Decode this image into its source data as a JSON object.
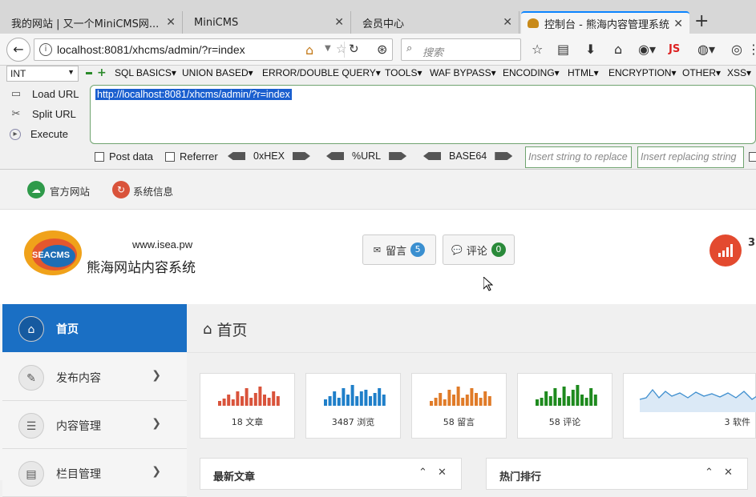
{
  "browser": {
    "tabs": [
      {
        "label": "我的网站 | 又一个MiniCMS网...",
        "active": false
      },
      {
        "label": "MiniCMS",
        "active": false
      },
      {
        "label": "会员中心",
        "active": false
      },
      {
        "label": "控制台 - 熊海内容管理系统",
        "active": true
      }
    ],
    "new_tab_icon": "+",
    "url": "localhost:8081/xhcms/admin/?r=index",
    "search_placeholder": "搜索",
    "js_label": "JS"
  },
  "hackbar": {
    "encoding_select": "INT",
    "menus": [
      "SQL BASICS▾",
      "UNION BASED▾",
      "ERROR/DOUBLE QUERY▾",
      "TOOLS▾",
      "WAF BYPASS▾",
      "ENCODING▾",
      "HTML▾",
      "ENCRYPTION▾",
      "OTHER▾",
      "XSS▾"
    ],
    "actions": {
      "load": "Load URL",
      "split": "Split URL",
      "execute": "Execute"
    },
    "textarea_value": "http://localhost:8081/xhcms/admin/?r=index",
    "post_data": "Post data",
    "referrer": "Referrer",
    "hex": "0xHEX",
    "url_enc": "%URL",
    "base64": "BASE64",
    "replace_placeholder": "Insert string to replace",
    "replacing_placeholder": "Insert replacing string"
  },
  "topbar": {
    "official_site": "官方网站",
    "system_info": "系统信息"
  },
  "header": {
    "logo_text": "SEACMS",
    "site_url": "www.isea.pw",
    "site_name": "熊海网站内容系统",
    "messages_label": "留言",
    "messages_count": "5",
    "comments_label": "评论",
    "comments_count": "0",
    "stat_partial": "3"
  },
  "sidebar": {
    "items": [
      {
        "label": "首页",
        "active": true
      },
      {
        "label": "发布内容",
        "active": false
      },
      {
        "label": "内容管理",
        "active": false
      },
      {
        "label": "栏目管理",
        "active": false
      }
    ]
  },
  "main": {
    "title": "首页",
    "cards": [
      {
        "label": "18 文章",
        "color": "#d9533b"
      },
      {
        "label": "3487 浏览",
        "color": "#1f7fc9"
      },
      {
        "label": "58 留言",
        "color": "#e07b28"
      },
      {
        "label": "58 评论",
        "color": "#1e8a1e"
      },
      {
        "label": "3 软件",
        "color": "#3f8fcf"
      }
    ],
    "panels": [
      {
        "title": "最新文章"
      },
      {
        "title": "热门排行"
      }
    ]
  },
  "colors": {
    "accent": "#1a6fc4",
    "hackbar_border": "#6fa36f",
    "selection": "#1a5fcf"
  }
}
